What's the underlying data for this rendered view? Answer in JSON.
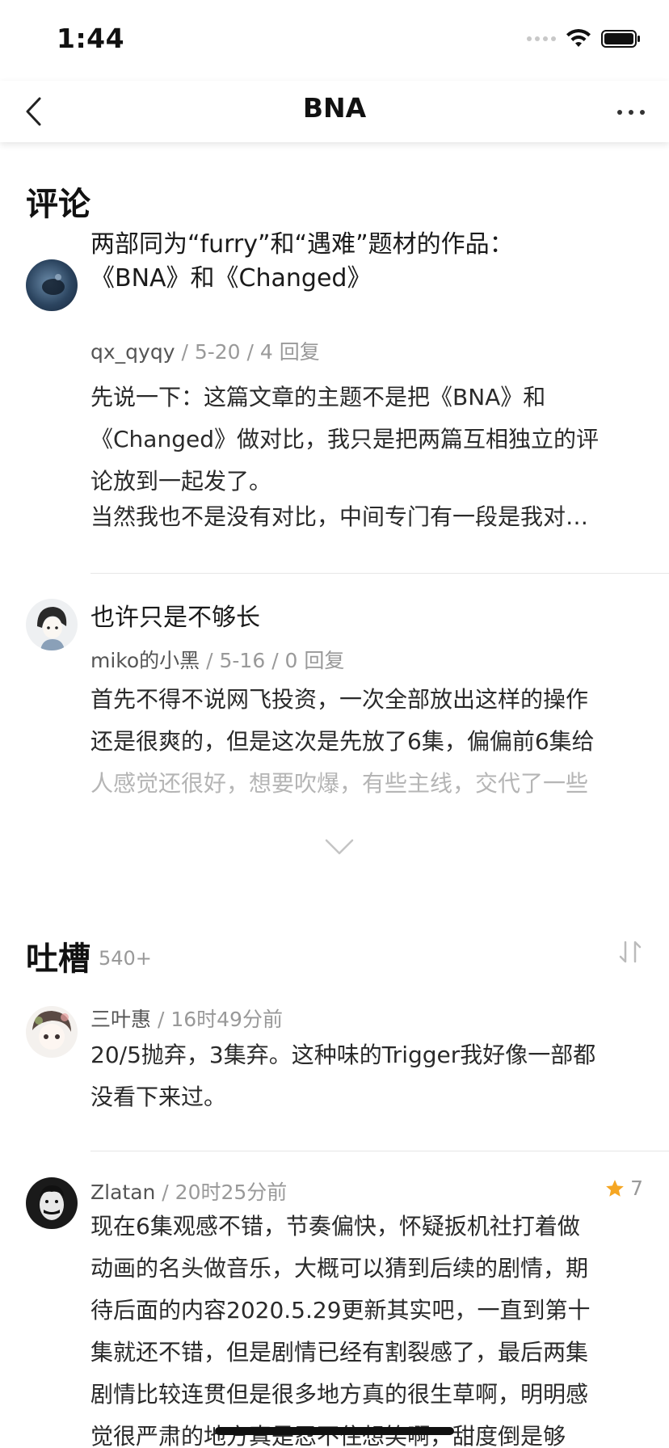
{
  "status": {
    "time": "1:44"
  },
  "nav": {
    "title": "BNA"
  },
  "reviews_section": {
    "title": "评论"
  },
  "reviews": [
    {
      "title_line1": "两部同为“furry”和“遇难”题材的作品：",
      "title_line2": "《BNA》和《Changed》",
      "author": "qx_qyqy",
      "meta": " / 5-20 / 4 回复",
      "body_lines": [
        "先说一下：这篇文章的主题不是把《BNA》和",
        "《Changed》做对比，我只是把两篇互相独立的评",
        "论放到一起发了。",
        "当然我也不是没有对比，中间专门有一段是我对…"
      ]
    },
    {
      "title_line1": "也许只是不够长",
      "author": "miko的小黑",
      "meta": " / 5-16 / 0 回复",
      "body_lines": [
        "首先不得不说网飞投资，一次全部放出这样的操作",
        "还是很爽的，但是这次是先放了6集，偏偏前6集给",
        "人感觉还很好，想要吹爆，有些主线，交代了一些"
      ]
    }
  ],
  "comments_section": {
    "title": "吐槽",
    "count": "540+"
  },
  "comments": [
    {
      "author": "三叶惠",
      "meta": " / 16时49分前",
      "body_lines": [
        "20/5抛弃，3集弃。这种味的Trigger我好像一部都",
        "没看下来过。"
      ]
    },
    {
      "author": "Zlatan",
      "meta": " / 20时25分前",
      "rating": "7",
      "body_lines": [
        "现在6集观感不错，节奏偏快，怀疑扳机社打着做",
        "动画的名头做音乐，大概可以猜到后续的剧情，期",
        "待后面的内容2020.5.29更新其实吧，一直到第十",
        "集就还不错，但是剧情已经有割裂感了，最后两集",
        "剧情比较连贯但是很多地方真的很生草啊，明明感",
        "觉很严肃的地方真是忍不住想笑啊，甜度倒是够"
      ]
    }
  ],
  "colors": {
    "star": "#f5a623",
    "divider": "#e6e6e6",
    "meta": "#999999"
  }
}
